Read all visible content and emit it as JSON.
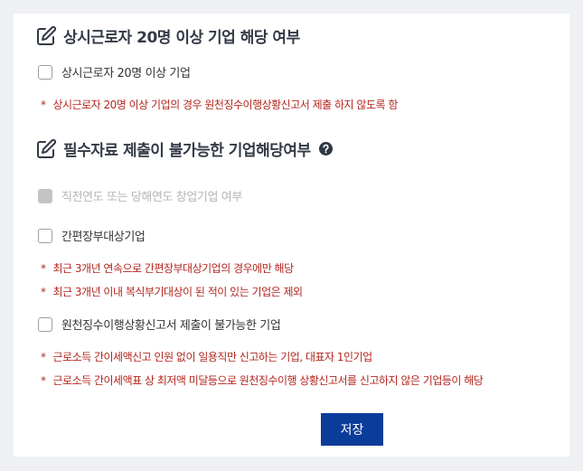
{
  "sections": [
    {
      "title": "상시근로자 20명 이상 기업 해당 여부",
      "checkboxes": [
        {
          "label": "상시근로자 20명 이상 기업",
          "checked": false,
          "disabled": false
        }
      ],
      "notes": [
        "상시근로자 20명 이상 기업의 경우 원천징수이행상황신고서 제출 하지 않도록 함"
      ]
    },
    {
      "title": "필수자료 제출이 불가능한 기업해당여부",
      "checkboxes": [
        {
          "label": "직전연도 또는 당해연도 창업기업 여부",
          "checked": false,
          "disabled": true
        },
        {
          "label": "간편장부대상기업",
          "checked": false,
          "disabled": false
        },
        {
          "label": "원천징수이행상황신고서 제출이 불가능한 기업",
          "checked": false,
          "disabled": false
        }
      ],
      "notes_group_1": [
        "최근 3개년 연속으로 간편장부대상기업의 경우에만 해당",
        "최근 3개년 이내 복식부기대상이 된 적이 있는 기업은 제외"
      ],
      "notes_group_2": [
        "근로소득 간이세액신고 인원 없이 일용직만 신고하는 기업, 대표자 1인기업",
        "근로소득 간이세액표 상 최저액 미달등으로 원천징수이행 상황신고서를 신고하지 않은 기업등이 해당"
      ]
    }
  ],
  "note_marker": "*",
  "save_label": "저장",
  "icons": {
    "section": "edit-icon",
    "help": "help-icon"
  },
  "colors": {
    "accent_button": "#0b3c9a",
    "note_text": "#b3261e",
    "title_text": "#333a46"
  }
}
